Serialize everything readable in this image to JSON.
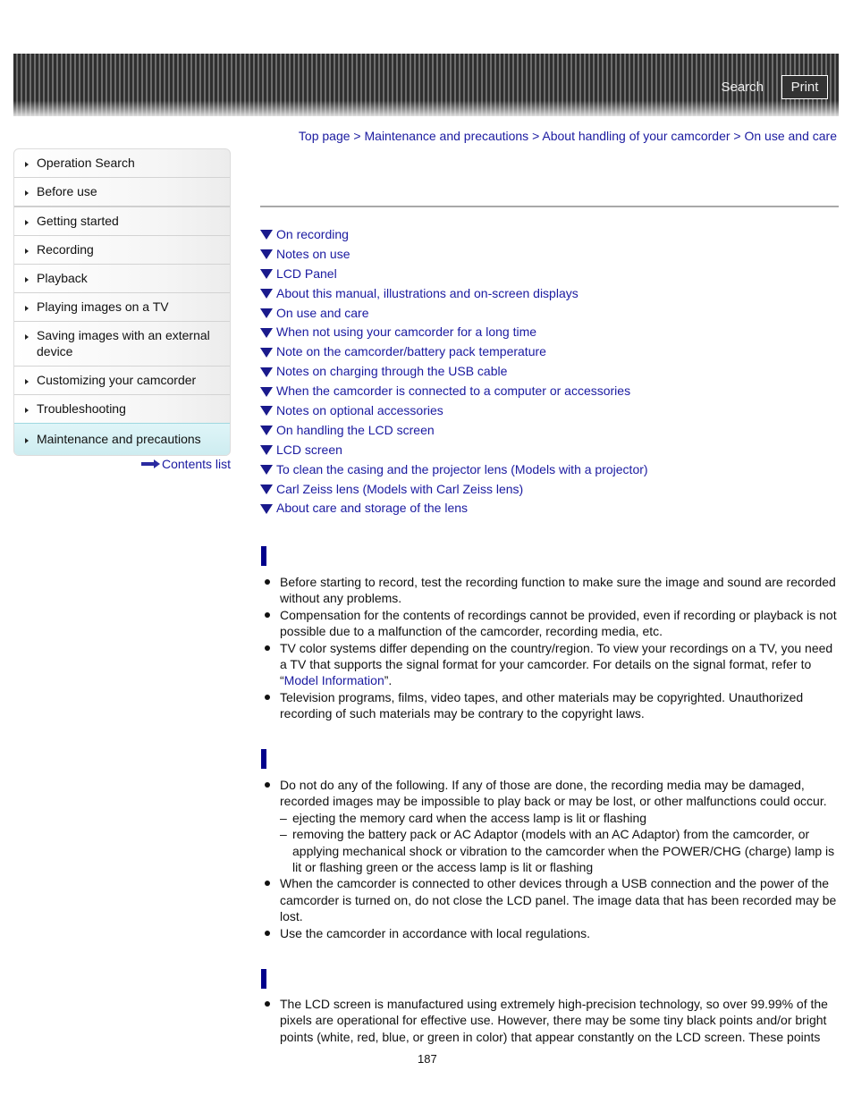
{
  "header": {
    "search_label": "Search",
    "print_label": "Print"
  },
  "breadcrumb": {
    "items": [
      "Top page",
      "Maintenance and precautions",
      "About handling of your camcorder",
      "On use and care"
    ],
    "separator": ">"
  },
  "sidebar": {
    "items": [
      {
        "label": "Operation Search"
      },
      {
        "label": "Before use"
      },
      {
        "label": "Getting started"
      },
      {
        "label": "Recording"
      },
      {
        "label": "Playback"
      },
      {
        "label": "Playing images on a TV"
      },
      {
        "label": "Saving images with an external device"
      },
      {
        "label": "Customizing your camcorder"
      },
      {
        "label": "Troubleshooting"
      },
      {
        "label": "Maintenance and precautions",
        "active": true
      }
    ],
    "contents_link": "Contents list"
  },
  "toc": [
    "On recording",
    "Notes on use",
    "LCD Panel",
    "About this manual, illustrations and on-screen displays",
    "On use and care",
    "When not using your camcorder for a long time",
    "Note on the camcorder/battery pack temperature",
    "Notes on charging through the USB cable",
    "When the camcorder is connected to a computer or accessories",
    "Notes on optional accessories",
    "On handling the LCD screen",
    "LCD screen",
    "To clean the casing and the projector lens (Models with a projector)",
    "Carl Zeiss lens (Models with Carl Zeiss lens)",
    "About care and storage of the lens"
  ],
  "sections": {
    "recording": {
      "bullets": [
        "Before starting to record, test the recording function to make sure the image and sound are recorded without any problems.",
        "Compensation for the contents of recordings cannot be provided, even if recording or playback is not possible due to a malfunction of the camcorder, recording media, etc.",
        {
          "text_before": "TV color systems differ depending on the country/region. To view your recordings on a TV, you need a TV that supports the signal format for your camcorder. For details on the signal format, refer to “",
          "link": "Model Information",
          "text_after": "”."
        },
        "Television programs, films, video tapes, and other materials may be copyrighted. Unauthorized recording of such materials may be contrary to the copyright laws."
      ]
    },
    "notes_on_use": {
      "bullets": [
        "Do not do any of the following. If any of those are done, the recording media may be damaged, recorded images may be impossible to play back or may be lost, or other malfunctions could occur.",
        "When the camcorder is connected to other devices through a USB connection and the power of the camcorder is turned on, do not close the LCD panel. The image data that has been recorded may be lost.",
        "Use the camcorder in accordance with local regulations."
      ],
      "sub_items": [
        "ejecting the memory card when the access lamp is lit or flashing",
        "removing the battery pack or AC Adaptor (models with an AC Adaptor) from the camcorder, or applying mechanical shock or vibration to the camcorder when the POWER/CHG (charge) lamp is lit or flashing green or the access lamp is lit or flashing"
      ]
    },
    "lcd_panel": {
      "bullets": [
        "The LCD screen is manufactured using extremely high-precision technology, so over 99.99% of the pixels are operational for effective use. However, there may be some tiny black points and/or bright points (white, red, blue, or green in color) that appear constantly on the LCD screen. These points"
      ]
    }
  },
  "footer": {
    "page_number": "187"
  },
  "colors": {
    "link": "#1a1aa0",
    "section_marker": "#00008b",
    "active_nav": "#d6f0f4"
  }
}
